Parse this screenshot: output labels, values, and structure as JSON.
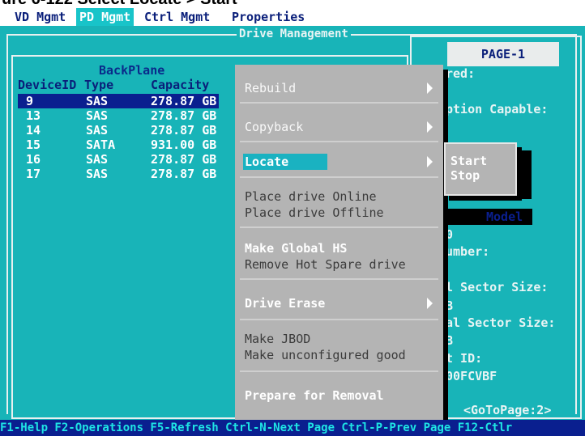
{
  "caption": "ure 6-122 Select Locate > Start",
  "menubar": {
    "tabs": [
      "VD Mgmt",
      "PD Mgmt",
      "Ctrl Mgmt",
      "Properties"
    ]
  },
  "drive_management": {
    "title": "Drive Management",
    "backplane_title": "BackPlane",
    "columns": [
      "DeviceID",
      "Type",
      "Capacity"
    ],
    "rows": [
      {
        "id": "9",
        "type": "SAS",
        "capacity": "278.87 GB"
      },
      {
        "id": "13",
        "type": "SAS",
        "capacity": "278.87 GB"
      },
      {
        "id": "14",
        "type": "SAS",
        "capacity": "278.87 GB"
      },
      {
        "id": "15",
        "type": "SATA",
        "capacity": "931.00 GB"
      },
      {
        "id": "16",
        "type": "SAS",
        "capacity": "278.87 GB"
      },
      {
        "id": "17",
        "type": "SAS",
        "capacity": "278.87 GB"
      }
    ]
  },
  "right_panel": {
    "page": "PAGE-1",
    "lines": [
      "red:",
      "ption Capable:",
      "Model",
      "0",
      "umber:",
      "l Sector Size:",
      "B",
      "al Sector Size:",
      "B",
      "t ID:",
      "00FCVBF",
      "<GoToPage:2>"
    ]
  },
  "context_menu": {
    "items": [
      "Rebuild",
      "Copyback",
      "Locate",
      "Place drive Online",
      "Place drive Offline",
      "Make Global HS",
      "Remove Hot Spare drive",
      "Drive Erase",
      "Make JBOD",
      "Make unconfigured good",
      "Prepare  for Removal"
    ]
  },
  "submenu": {
    "items": [
      "Start",
      "Stop"
    ]
  },
  "statusbar": {
    "text": "F1-Help F2-Operations F5-Refresh Ctrl-N-Next Page Ctrl-P-Prev Page F12-Ctlr"
  }
}
